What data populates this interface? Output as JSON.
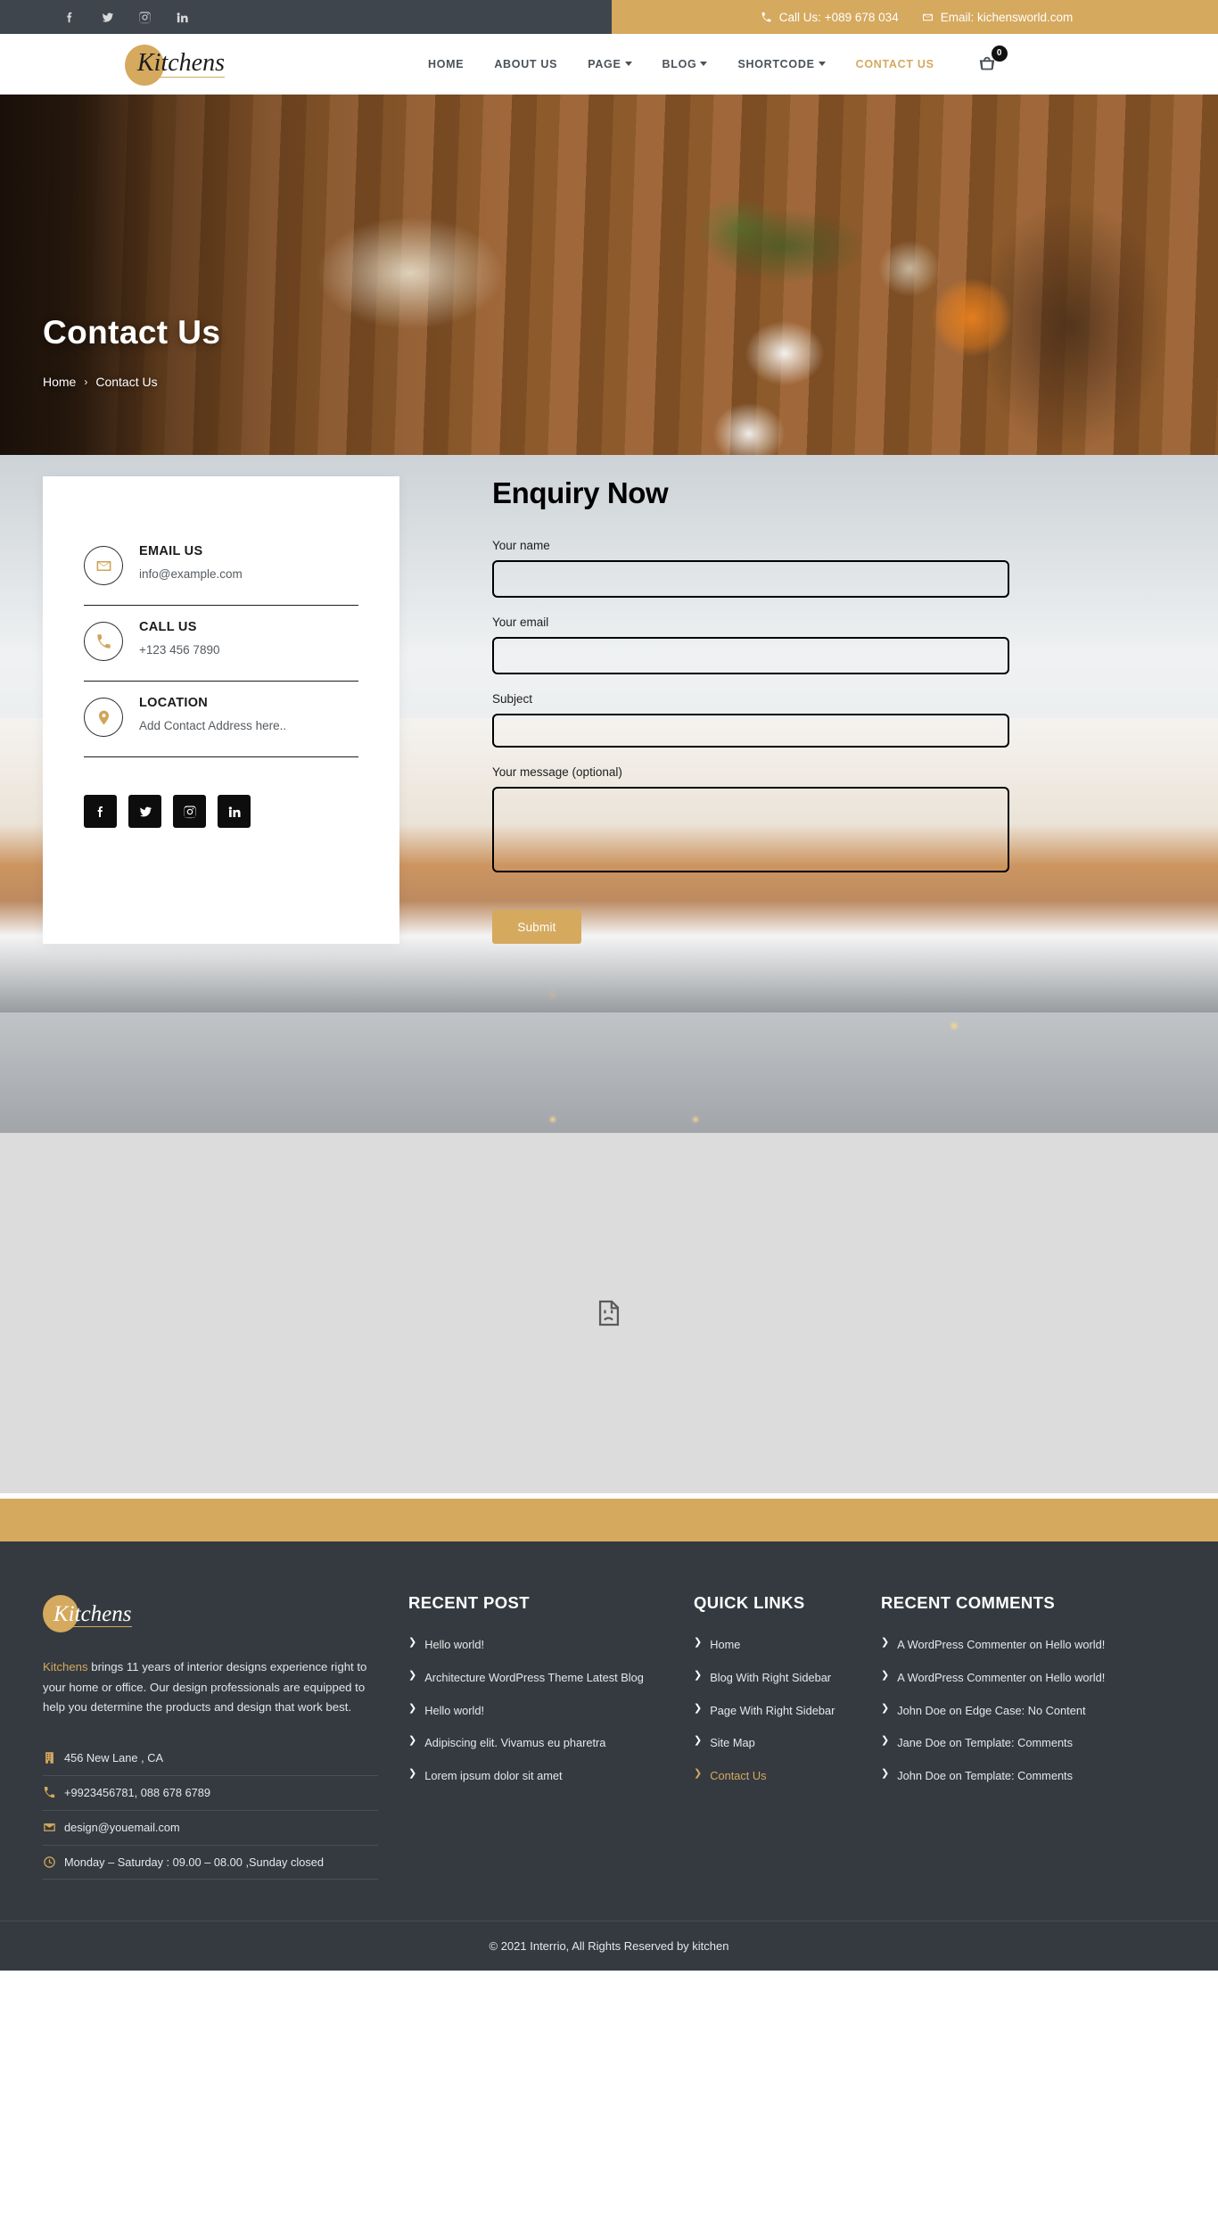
{
  "topbar": {
    "social": [
      {
        "name": "facebook-icon",
        "label": "Facebook"
      },
      {
        "name": "twitter-icon",
        "label": "Twitter"
      },
      {
        "name": "instagram-icon",
        "label": "Instagram"
      },
      {
        "name": "linkedin-icon",
        "label": "LinkedIn"
      }
    ],
    "call": "Call Us: +089 678 034",
    "email": "Email: kichensworld.com",
    "accent_color": "#d5a95e",
    "bg_color": "#3e454c"
  },
  "header": {
    "logo": "Kitchens",
    "nav": [
      {
        "label": "HOME",
        "dropdown": false,
        "active": false
      },
      {
        "label": "ABOUT US",
        "dropdown": false,
        "active": false
      },
      {
        "label": "PAGE",
        "dropdown": true,
        "active": false
      },
      {
        "label": "BLOG",
        "dropdown": true,
        "active": false
      },
      {
        "label": "SHORTCODE",
        "dropdown": true,
        "active": false
      },
      {
        "label": "CONTACT US",
        "dropdown": false,
        "active": true
      }
    ],
    "cart_count": "0"
  },
  "hero": {
    "title": "Contact Us",
    "breadcrumb_home": "Home",
    "breadcrumb_sep": "›",
    "breadcrumb_current": "Contact Us"
  },
  "info_card": {
    "items": [
      {
        "icon": "envelope-icon",
        "title": "EMAIL US",
        "value": "info@example.com"
      },
      {
        "icon": "phone-icon",
        "title": "CALL US",
        "value": "+123 456 7890"
      },
      {
        "icon": "location-pin-icon",
        "title": "LOCATION",
        "value": "Add Contact Address here.."
      }
    ],
    "social": [
      {
        "name": "facebook-icon",
        "label": "Facebook"
      },
      {
        "name": "twitter-icon",
        "label": "Twitter"
      },
      {
        "name": "instagram-icon",
        "label": "Instagram"
      },
      {
        "name": "linkedin-icon",
        "label": "LinkedIn"
      }
    ]
  },
  "form": {
    "title": "Enquiry Now",
    "name_label": "Your name",
    "name_value": "",
    "email_label": "Your email",
    "email_value": "",
    "subject_label": "Subject",
    "subject_value": "",
    "message_label": "Your message (optional)",
    "message_value": "",
    "submit_label": "Submit"
  },
  "map": {
    "placeholder_icon": "broken-image-icon"
  },
  "footer": {
    "logo": "Kitchens",
    "brand_word": "Kitchens",
    "description": " brings 11 years of interior designs experience right to your home or office. Our design professionals are equipped to help you determine the products and design that work best.",
    "contacts": [
      {
        "icon": "building-icon",
        "text": "456 New Lane , CA"
      },
      {
        "icon": "phone-icon",
        "text": "+9923456781, 088 678 6789"
      },
      {
        "icon": "envelope-icon",
        "text": "design@youemail.com"
      },
      {
        "icon": "clock-icon",
        "text": "Monday – Saturday : 09.00 – 08.00 ,Sunday closed"
      }
    ],
    "recent_post": {
      "heading": "RECENT POST",
      "items": [
        "Hello world!",
        "Architecture WordPress Theme Latest Blog",
        "Hello world!",
        "Adipiscing elit. Vivamus eu pharetra",
        "Lorem ipsum dolor sit amet"
      ]
    },
    "quick_links": {
      "heading": "QUICK LINKS",
      "items": [
        {
          "label": "Home",
          "active": false
        },
        {
          "label": "Blog With Right Sidebar",
          "active": false
        },
        {
          "label": "Page With Right Sidebar",
          "active": false
        },
        {
          "label": "Site Map",
          "active": false
        },
        {
          "label": "Contact Us",
          "active": true
        }
      ]
    },
    "recent_comments": {
      "heading": "RECENT COMMENTS",
      "items": [
        "A WordPress Commenter on Hello world!",
        "A WordPress Commenter on Hello world!",
        "John Doe on Edge Case: No Content",
        "Jane Doe on Template: Comments",
        "John Doe on Template: Comments"
      ]
    },
    "copyright": "© 2021 Interrio, All Rights Reserved by kitchen"
  }
}
